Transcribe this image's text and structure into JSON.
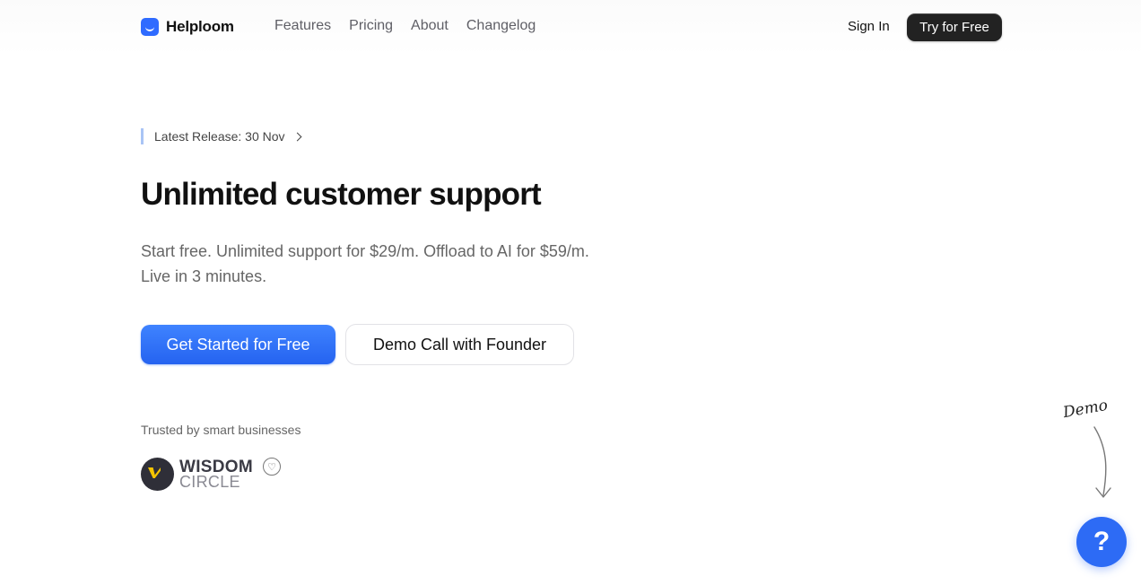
{
  "brand": {
    "name": "Helploom",
    "accent": "#2f6bff"
  },
  "nav": {
    "links": [
      "Features",
      "Pricing",
      "About",
      "Changelog"
    ],
    "signin": "Sign In",
    "try": "Try for Free"
  },
  "hero": {
    "release": "Latest Release: 30 Nov",
    "title": "Unlimited customer support",
    "subtitle_line1": "Start free. Unlimited support for $29/m. Offload to AI for $59/m.",
    "subtitle_line2": "Live in 3 minutes.",
    "primary_cta": "Get Started for Free",
    "secondary_cta": "Demo Call with Founder"
  },
  "trusted": {
    "label": "Trusted by smart businesses",
    "logo_line1": "WISDOM",
    "logo_line2": "CIRCLE"
  },
  "demo": {
    "label": "Demo"
  },
  "help": {
    "icon": "?"
  }
}
